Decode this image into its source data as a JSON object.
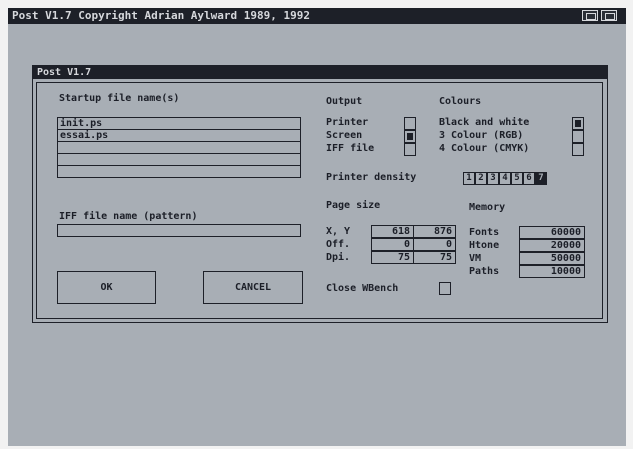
{
  "screen": {
    "title": "Post V1.7 Copyright Adrian Aylward 1989, 1992"
  },
  "window": {
    "title": "Post V1.7"
  },
  "startup": {
    "label": "Startup file name(s)",
    "files": [
      "init.ps",
      "essai.ps",
      "",
      "",
      ""
    ]
  },
  "iff": {
    "label": "IFF file name (pattern)",
    "value": ""
  },
  "buttons": {
    "ok": "OK",
    "cancel": "CANCEL"
  },
  "output": {
    "label": "Output",
    "options": [
      {
        "label": "Printer",
        "checked": false
      },
      {
        "label": "Screen",
        "checked": true
      },
      {
        "label": "IFF file",
        "checked": false
      }
    ]
  },
  "colours": {
    "label": "Colours",
    "options": [
      {
        "label": "Black and white",
        "checked": true
      },
      {
        "label": "3 Colour (RGB)",
        "checked": false
      },
      {
        "label": "4 Colour (CMYK)",
        "checked": false
      }
    ]
  },
  "density": {
    "label": "Printer density",
    "values": [
      "1",
      "2",
      "3",
      "4",
      "5",
      "6",
      "7"
    ],
    "selected": "7"
  },
  "page_size": {
    "label": "Page size",
    "rows": [
      {
        "label": "X, Y",
        "a": "618",
        "b": "876"
      },
      {
        "label": "Off.",
        "a": "0",
        "b": "0"
      },
      {
        "label": "Dpi.",
        "a": "75",
        "b": "75"
      }
    ]
  },
  "memory": {
    "label": "Memory",
    "rows": [
      {
        "label": "Fonts",
        "value": "60000"
      },
      {
        "label": "Htone",
        "value": "20000"
      },
      {
        "label": "VM",
        "value": "50000"
      },
      {
        "label": "Paths",
        "value": "10000"
      }
    ]
  },
  "close_wbench": {
    "label": "Close WBench",
    "checked": false
  }
}
